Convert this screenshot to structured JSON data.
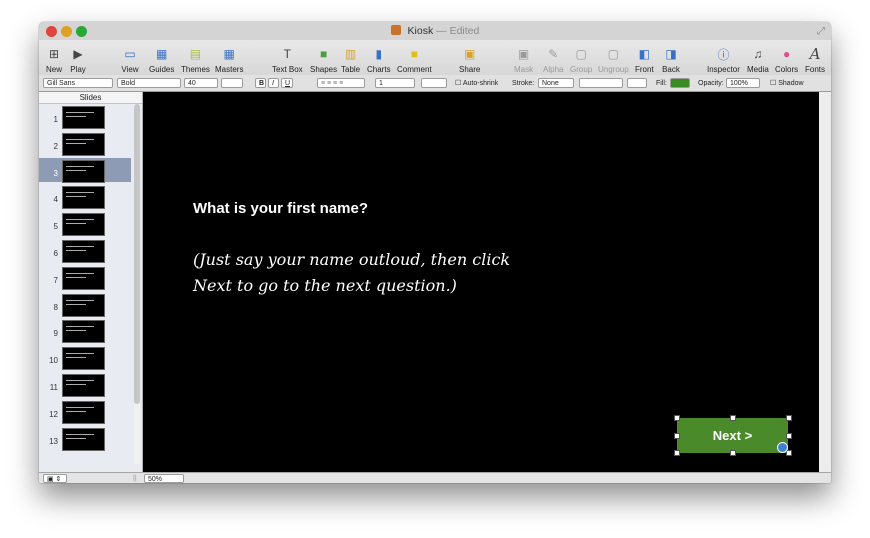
{
  "window": {
    "title": "Kiosk",
    "edited": "— Edited"
  },
  "toolbar": {
    "new_label": "New",
    "play_label": "Play",
    "view_label": "View",
    "guides_label": "Guides",
    "themes_label": "Themes",
    "masters_label": "Masters",
    "textbox_label": "Text Box",
    "shapes_label": "Shapes",
    "table_label": "Table",
    "charts_label": "Charts",
    "comment_label": "Comment",
    "share_label": "Share",
    "mask_label": "Mask",
    "alpha_label": "Alpha",
    "group_label": "Group",
    "ungroup_label": "Ungroup",
    "front_label": "Front",
    "back_label": "Back",
    "inspector_label": "Inspector",
    "media_label": "Media",
    "colors_label": "Colors",
    "fonts_label": "Fonts"
  },
  "formatbar": {
    "font_family": "Gill Sans",
    "font_style": "Bold",
    "font_size": "40",
    "bold": "B",
    "italic": "I",
    "underline": "U",
    "line_spacing": "1",
    "autoshrink_label": "Auto-shrink",
    "stroke_label": "Stroke:",
    "stroke_value": "None",
    "fill_label": "Fill:",
    "fill_color": "#3c8a22",
    "opacity_label": "Opacity:",
    "opacity_value": "100%",
    "shadow_label": "Shadow"
  },
  "sidebar": {
    "header": "Slides",
    "slides": [
      "1",
      "2",
      "3",
      "4",
      "5",
      "6",
      "7",
      "8",
      "9",
      "10",
      "11",
      "12",
      "13"
    ],
    "selected": "3"
  },
  "slide": {
    "heading": "What is your first name?",
    "body_line1": "(Just say your name outloud, then click",
    "body_line2": "Next to go to the next question.)",
    "next_button": "Next >",
    "next_button_color": "#4a8a2a"
  },
  "status": {
    "zoom": "50%"
  }
}
